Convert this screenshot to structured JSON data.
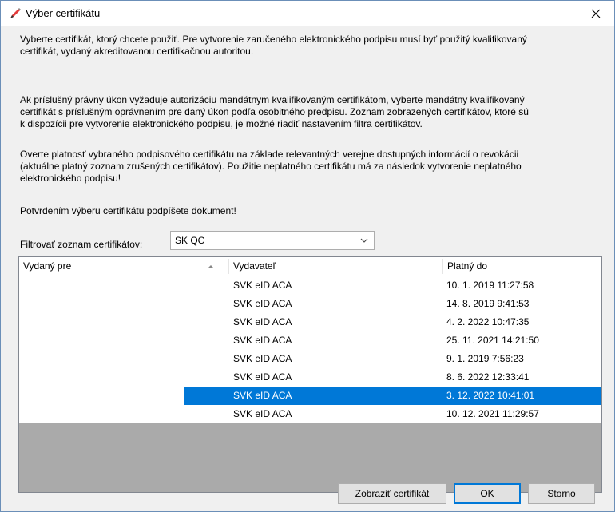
{
  "window": {
    "title": "Výber certifikátu",
    "close_glyph": "✕"
  },
  "paragraphs": [
    [
      "Vyberte certifikát, ktorý chcete použiť. Pre vytvorenie zaručeného elektronického podpisu musí byť použitý kvalifikovaný",
      "certifikát, vydaný akreditovanou certifikačnou autoritou."
    ],
    [
      "Ak príslušný právny úkon vyžaduje autorizáciu mandátnym kvalifikovaným certifikátom, vyberte mandátny kvalifikovaný",
      "certifikát s príslušným oprávnením pre daný úkon podľa osobitného predpisu. Zoznam zobrazených certifikátov, ktoré sú",
      "k dispozícii pre vytvorenie elektronického podpisu, je možné riadiť nastavením filtra certifikátov."
    ],
    [
      "Overte platnosť vybraného podpisového certifikátu na základe relevantných verejne dostupných informácií o revokácii",
      "(aktuálne platný zoznam zrušených certifikátov). Použitie neplatného certifikátu má za následok vytvorenie neplatného",
      "elektronického podpisu!"
    ],
    [
      "Potvrdením výberu certifikátu podpíšete dokument!"
    ]
  ],
  "filter": {
    "label": "Filtrovať zoznam certifikátov:",
    "selected": "SK QC"
  },
  "table": {
    "columns": [
      "Vydaný pre",
      "Vydavateľ",
      "Platný do"
    ],
    "rows": [
      {
        "issued_to": "",
        "issuer": "SVK eID ACA",
        "valid_to": "10. 1. 2019 11:27:58",
        "selected": false
      },
      {
        "issued_to": "",
        "issuer": "SVK eID ACA",
        "valid_to": "14. 8. 2019 9:41:53",
        "selected": false
      },
      {
        "issued_to": "",
        "issuer": "SVK eID ACA",
        "valid_to": "4. 2. 2022 10:47:35",
        "selected": false
      },
      {
        "issued_to": "",
        "issuer": "SVK eID ACA",
        "valid_to": "25. 11. 2021 14:21:50",
        "selected": false
      },
      {
        "issued_to": "",
        "issuer": "SVK eID ACA",
        "valid_to": "9. 1. 2019 7:56:23",
        "selected": false
      },
      {
        "issued_to": "",
        "issuer": "SVK eID ACA",
        "valid_to": "8. 6. 2022 12:33:41",
        "selected": false
      },
      {
        "issued_to": "",
        "issuer": "SVK eID ACA",
        "valid_to": "3. 12. 2022 10:41:01",
        "selected": true
      },
      {
        "issued_to": "",
        "issuer": "SVK eID ACA",
        "valid_to": "10. 12. 2021 11:29:57",
        "selected": false
      }
    ]
  },
  "buttons": {
    "show_cert": "Zobraziť certifikát",
    "ok": "OK",
    "cancel": "Storno"
  },
  "colors": {
    "selection": "#0078d7",
    "list_empty": "#aaaaaa",
    "window_border": "#6b8fb8"
  }
}
